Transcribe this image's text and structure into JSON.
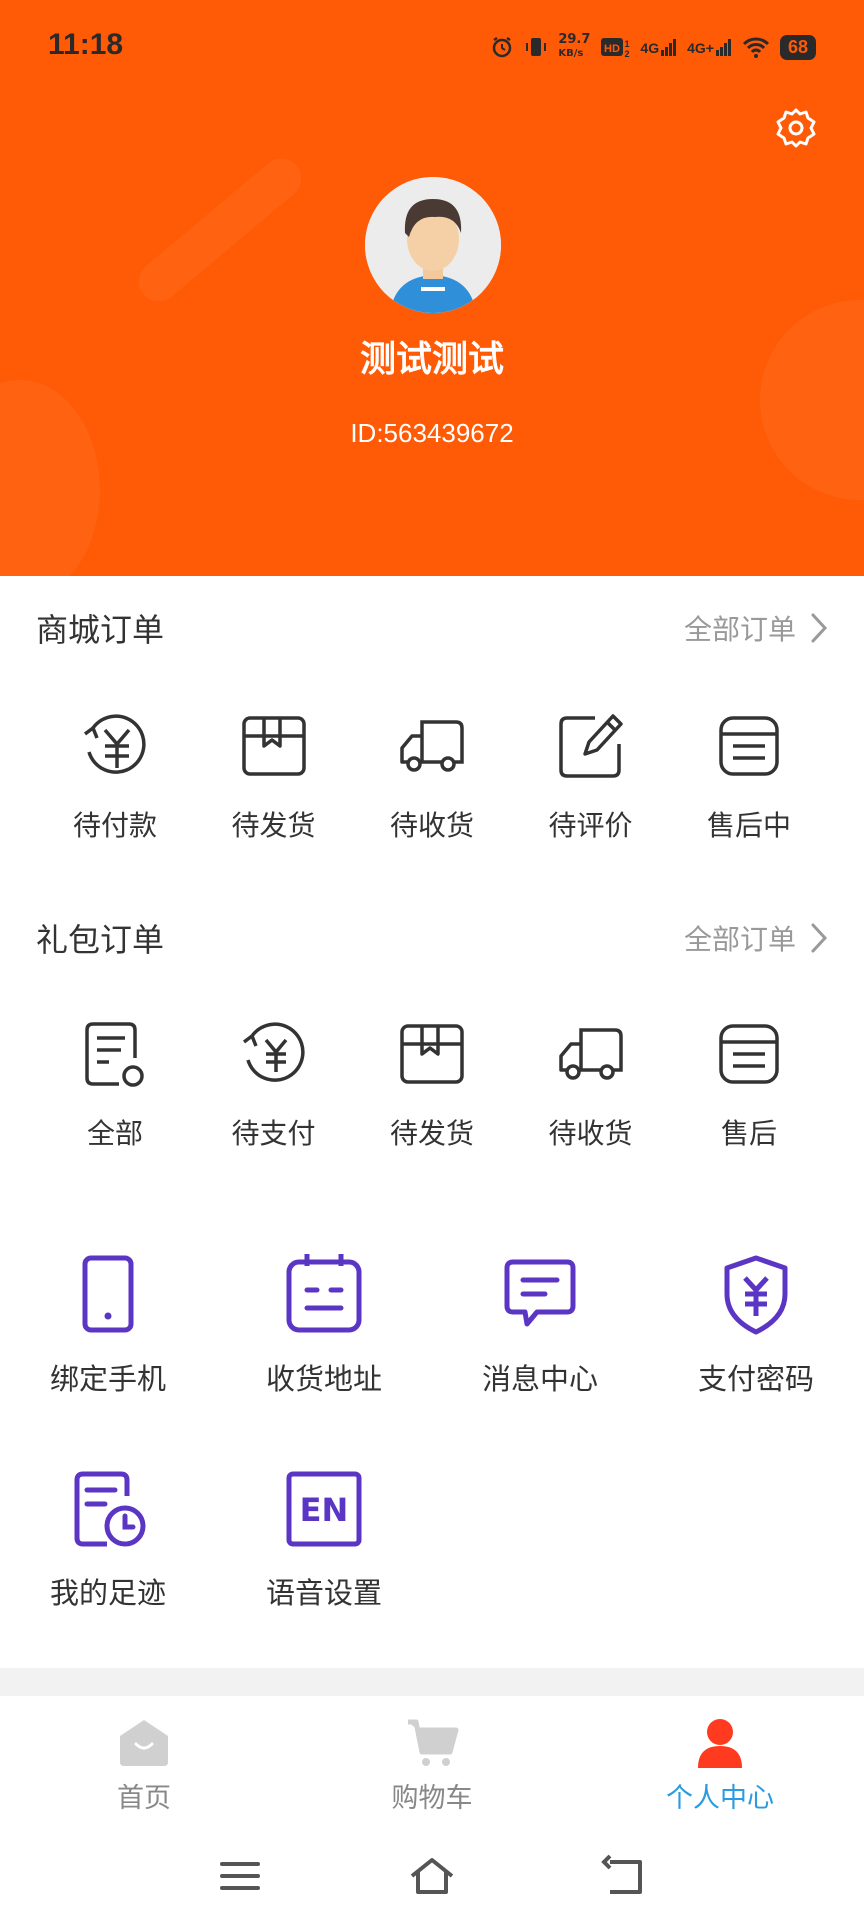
{
  "status_bar": {
    "time": "11:18",
    "speed_value": "29.7",
    "speed_unit": "KB/s",
    "net1": "4G",
    "net2": "4G+",
    "battery": "68"
  },
  "profile": {
    "name": "测试测试",
    "id_text": "ID:563439672"
  },
  "mall_orders": {
    "title": "商城订单",
    "all_label": "全部订单",
    "items": [
      {
        "label": "待付款",
        "icon": "yen-refresh-icon"
      },
      {
        "label": "待发货",
        "icon": "box-icon"
      },
      {
        "label": "待收货",
        "icon": "truck-icon"
      },
      {
        "label": "待评价",
        "icon": "edit-icon"
      },
      {
        "label": "售后中",
        "icon": "list-icon"
      }
    ]
  },
  "gift_orders": {
    "title": "礼包订单",
    "all_label": "全部订单",
    "items": [
      {
        "label": "全部",
        "icon": "document-icon"
      },
      {
        "label": "待支付",
        "icon": "yen-refresh-icon"
      },
      {
        "label": "待发货",
        "icon": "box-icon"
      },
      {
        "label": "待收货",
        "icon": "truck-icon"
      },
      {
        "label": "售后",
        "icon": "list-icon"
      }
    ]
  },
  "tools": [
    {
      "label": "绑定手机",
      "icon": "phone-icon"
    },
    {
      "label": "收货地址",
      "icon": "address-icon"
    },
    {
      "label": "消息中心",
      "icon": "message-icon"
    },
    {
      "label": "支付密码",
      "icon": "shield-yen-icon"
    },
    {
      "label": "我的足迹",
      "icon": "history-icon"
    },
    {
      "label": "语音设置",
      "icon": "language-icon"
    }
  ],
  "language_icon_text": "EN",
  "tabbar": {
    "items": [
      {
        "label": "首页",
        "icon": "home-icon",
        "active": false
      },
      {
        "label": "购物车",
        "icon": "cart-icon",
        "active": false
      },
      {
        "label": "个人中心",
        "icon": "person-icon",
        "active": true
      }
    ]
  },
  "colors": {
    "header_bg": "#ff5a05",
    "tool_icon": "#5b35c4",
    "active_tab": "#2a9be0",
    "active_tab_icon": "#ff3b1f"
  }
}
